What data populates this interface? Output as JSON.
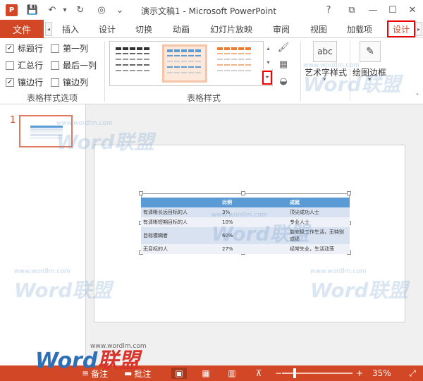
{
  "window": {
    "title": "演示文稿1 - Microsoft PowerPoint",
    "logo": "P",
    "help": "?",
    "ribbon_toggle": "⧉",
    "minimize": "—",
    "maximize": "☐",
    "close": "✕"
  },
  "quick_access": {
    "save_icon": "💾",
    "undo_icon": "↶",
    "dropdown": "▾",
    "redo_icon": "↻",
    "touch_icon": "◎",
    "more": "⌄"
  },
  "tabs": {
    "file": "文件",
    "items": [
      "插入",
      "设计",
      "切换",
      "动画",
      "幻灯片放映",
      "审阅",
      "视图",
      "加载项"
    ],
    "active": "设计"
  },
  "table_style_options": {
    "label": "表格样式选项",
    "options": [
      {
        "label": "标题行",
        "checked": true
      },
      {
        "label": "第一列",
        "checked": false
      },
      {
        "label": "汇总行",
        "checked": false
      },
      {
        "label": "最后一列",
        "checked": false
      },
      {
        "label": "镶边行",
        "checked": true
      },
      {
        "label": "镶边列",
        "checked": false
      }
    ]
  },
  "table_styles": {
    "label": "表格样式",
    "thumbs": [
      {
        "header": "#333333",
        "row_a": "#666666",
        "row_b": "#999999"
      },
      {
        "header": "#5b9bd5",
        "row_a": "#5b9bd5",
        "row_b": "#cfcfcf"
      },
      {
        "header": "#ed7d31",
        "row_a": "#f4b183",
        "row_b": "#cfcfcf"
      }
    ]
  },
  "ribbon_tools": {
    "shading_icon": "🖌",
    "border_icon": "▦",
    "effects_icon": "◒",
    "wordart_label": "艺术字样式",
    "wordart_icon": "abc",
    "draw_border_label": "绘图边框",
    "draw_border_icon": "✎"
  },
  "slides": {
    "current_number": "1"
  },
  "table": {
    "headers": [
      "",
      "比例",
      "成就"
    ],
    "rows": [
      [
        "有清晰长远目标的人",
        "3%",
        "顶尖成功人士"
      ],
      [
        "有清晰短期目标的人",
        "10%",
        "专业人士"
      ],
      [
        "目标模糊者",
        "60%",
        "能安稳工作生活，无特别成绩"
      ],
      [
        "无目标的人",
        "27%",
        "经常失业，生活动荡"
      ]
    ]
  },
  "statusbar": {
    "notes": "备注",
    "comments": "批注",
    "notes_icon": "≡",
    "comments_icon": "▬",
    "zoom_minus": "−",
    "zoom_plus": "+",
    "zoom_level": "35%",
    "zoom_level_fraction": 0.35
  },
  "watermark": {
    "text": "Word联盟",
    "url": "www.wordlm.com",
    "brand_word": "Word",
    "brand_suffix": "联盟"
  },
  "colors": {
    "accent": "#d24726",
    "table_header": "#5b9bd5"
  }
}
